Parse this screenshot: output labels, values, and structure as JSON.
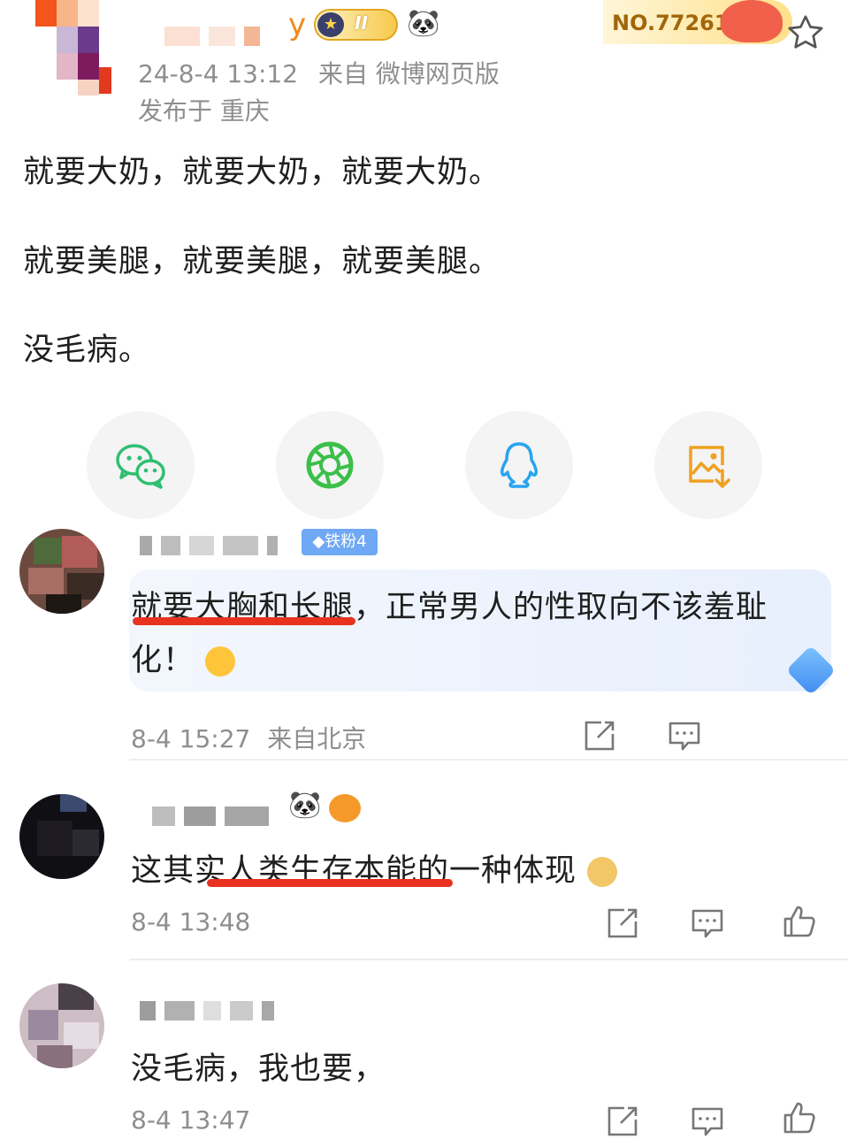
{
  "post": {
    "author_suffix": "y",
    "level_badge": "II",
    "fans_number": "NO.772618",
    "timestamp": "24-8-4 13:12",
    "source": "来自 微博网页版",
    "location": "发布于 重庆",
    "lines": [
      "就要大奶，就要大奶，就要大奶。",
      "就要美腿，就要美腿，就要美腿。",
      "没毛病。"
    ]
  },
  "share": [
    {
      "name": "wechat-share-button",
      "icon": "wechat-icon",
      "color": "#2fbf71"
    },
    {
      "name": "moments-share-button",
      "icon": "moments-icon",
      "color": "#3cbf4a"
    },
    {
      "name": "qq-share-button",
      "icon": "qq-icon",
      "color": "#28a4f0"
    },
    {
      "name": "save-image-button",
      "icon": "save-image-icon",
      "color": "#f0a020"
    }
  ],
  "comments": [
    {
      "badge": "铁粉4",
      "text_line1": "就要大胸和长腿，正常男人的性取向不该羞耻",
      "text_line2": "化！",
      "time": "8-4 15:27",
      "location": "来自北京"
    },
    {
      "text": "这其实人类生存本能的一种体现",
      "time": "8-4 13:48"
    },
    {
      "text": "没毛病，我也要，",
      "time": "8-4 13:47"
    }
  ],
  "colors": {
    "accent_underline": "#e8321f",
    "meta_gray": "#8e8e8e",
    "fans_gold": "#a2660a"
  }
}
